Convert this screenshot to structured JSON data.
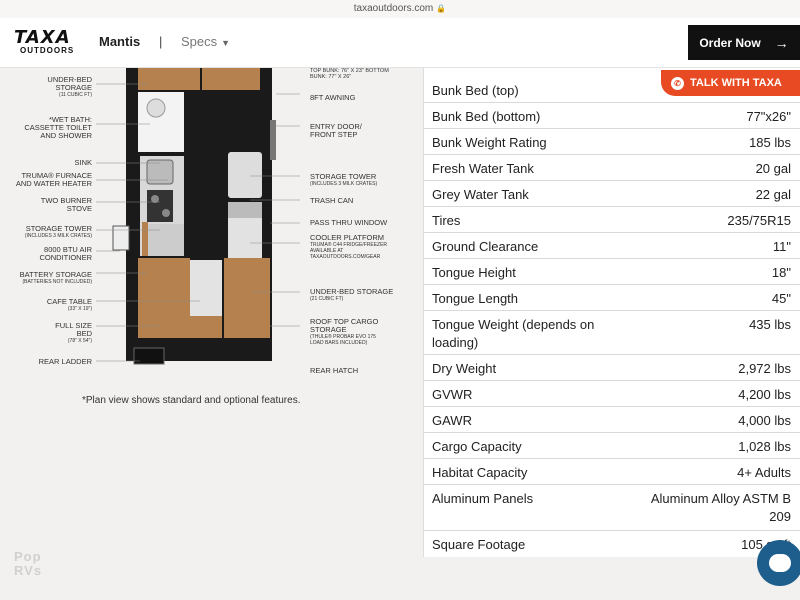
{
  "browser": {
    "url": "taxaoutdoors.com",
    "lock_icon": "lock-icon"
  },
  "header": {
    "logo_mark": "TAXA",
    "logo_sub": "OUTDOORS",
    "model": "Mantis",
    "separator": "|",
    "specs_menu": "Specs",
    "order_button": "Order Now",
    "order_arrow": "→"
  },
  "talk_button": {
    "label": "TALK WITH TAXA"
  },
  "plan": {
    "labels_left": [
      {
        "text": "UNDER-BED STORAGE",
        "sub": "(11 CUBIC FT)"
      },
      {
        "text": "*WET BATH: CASSETTE TOILET AND SHOWER",
        "sub": ""
      },
      {
        "text": "SINK",
        "sub": ""
      },
      {
        "text": "TRUMA® FURNACE AND WATER HEATER",
        "sub": ""
      },
      {
        "text": "TWO BURNER STOVE",
        "sub": ""
      },
      {
        "text": "STORAGE TOWER",
        "sub": "(INCLUDES 3 MILK CRATES)"
      },
      {
        "text": "8000 BTU AIR CONDITIONER",
        "sub": ""
      },
      {
        "text": "BATTERY STORAGE",
        "sub": "(BATTERIES NOT INCLUDED)"
      },
      {
        "text": "CAFE TABLE",
        "sub": "(33\" X 19\")"
      },
      {
        "text": "FULL SIZE BED",
        "sub": "(78\" X 54\")"
      },
      {
        "text": "REAR LADDER",
        "sub": ""
      }
    ],
    "labels_right": [
      {
        "text": "TOP BUNK: 76\" X 23\" BOTTOM BUNK: 77\" X 26\"",
        "sub": ""
      },
      {
        "text": "8FT AWNING",
        "sub": ""
      },
      {
        "text": "ENTRY DOOR/ FRONT STEP",
        "sub": ""
      },
      {
        "text": "STORAGE TOWER",
        "sub": "(INCLUDES 3 MILK CRATES)"
      },
      {
        "text": "TRASH CAN",
        "sub": ""
      },
      {
        "text": "PASS THRU WINDOW",
        "sub": ""
      },
      {
        "text": "COOLER PLATFORM",
        "sub": "TRUMA® C44 FRIDGE/FREEZER AVAILABLE AT TAXAOUTDOORS.COM/GEAR"
      },
      {
        "text": "UNDER-BED STORAGE",
        "sub": "(21 CUBIC FT)"
      },
      {
        "text": "ROOF TOP CARGO STORAGE",
        "sub": "(THULE® PROBAR EVO 175 LOAD BARS INCLUDED)"
      },
      {
        "text": "REAR HATCH",
        "sub": ""
      }
    ],
    "note": "*Plan view shows standard and optional features.",
    "watermark_1": "Pop",
    "watermark_2": "RVs"
  },
  "specs": [
    {
      "key": "Bunk Bed (top)",
      "value": ""
    },
    {
      "key": "Bunk Bed (bottom)",
      "value": "77\"x26\""
    },
    {
      "key": "Bunk Weight Rating",
      "value": "185 lbs"
    },
    {
      "key": "Fresh Water Tank",
      "value": "20 gal"
    },
    {
      "key": "Grey Water Tank",
      "value": "22 gal"
    },
    {
      "key": "Tires",
      "value": "235/75R15"
    },
    {
      "key": "Ground Clearance",
      "value": "11\""
    },
    {
      "key": "Tongue Height",
      "value": "18\""
    },
    {
      "key": "Tongue Length",
      "value": "45\""
    },
    {
      "key": "Tongue Weight (depends on loading)",
      "value": "435 lbs"
    },
    {
      "key": "Dry Weight",
      "value": "2,972 lbs"
    },
    {
      "key": "GVWR",
      "value": "4,200 lbs"
    },
    {
      "key": "GAWR",
      "value": "4,000 lbs"
    },
    {
      "key": "Cargo Capacity",
      "value": "1,028 lbs"
    },
    {
      "key": "Habitat Capacity",
      "value": "4+ Adults"
    },
    {
      "key": "Aluminum Panels",
      "value": "Aluminum Alloy ASTM B 209"
    },
    {
      "key": "Square Footage",
      "value": "105 sq ft"
    }
  ],
  "colors": {
    "accent": "#e84b23",
    "order_bg": "#111111",
    "chat": "#1d5e8c",
    "wood": "#b5824f"
  }
}
